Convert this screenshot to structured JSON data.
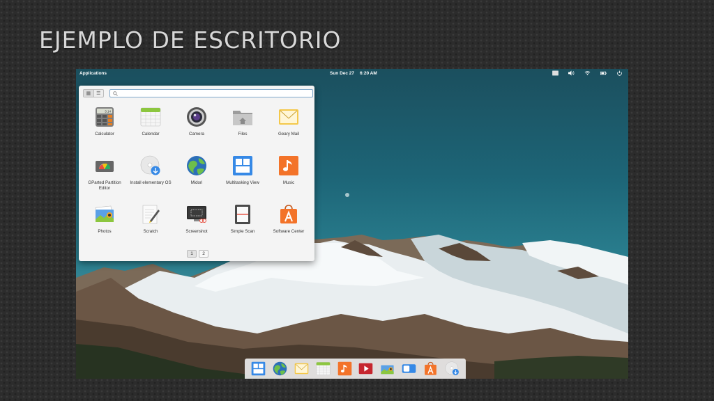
{
  "slide": {
    "title": "EJEMPLO DE ESCRITORIO"
  },
  "panel": {
    "applications_label": "Applications",
    "date": "Sun Dec 27",
    "time": "6:20 AM",
    "indicators": [
      "keyboard-icon",
      "volume-icon",
      "wifi-icon",
      "battery-icon",
      "power-icon"
    ]
  },
  "launcher": {
    "search_value": "",
    "apps": [
      {
        "label": "Calculator",
        "icon": "calculator-icon"
      },
      {
        "label": "Calendar",
        "icon": "calendar-icon"
      },
      {
        "label": "Camera",
        "icon": "camera-icon"
      },
      {
        "label": "Files",
        "icon": "files-icon"
      },
      {
        "label": "Geary Mail",
        "icon": "mail-icon"
      },
      {
        "label": "GParted Partition Editor",
        "icon": "gparted-icon"
      },
      {
        "label": "Install elementary OS",
        "icon": "installer-icon"
      },
      {
        "label": "Midori",
        "icon": "midori-icon"
      },
      {
        "label": "Multitasking View",
        "icon": "multitasking-icon"
      },
      {
        "label": "Music",
        "icon": "music-icon"
      },
      {
        "label": "Photos",
        "icon": "photos-icon"
      },
      {
        "label": "Scratch",
        "icon": "scratch-icon"
      },
      {
        "label": "Screenshot",
        "icon": "screenshot-icon"
      },
      {
        "label": "Simple Scan",
        "icon": "scan-icon"
      },
      {
        "label": "Software Center",
        "icon": "software-center-icon"
      }
    ],
    "pages": [
      "1",
      "2"
    ],
    "calculator_display": "3.14"
  },
  "dock": {
    "items": [
      "multitasking-icon",
      "midori-icon",
      "mail-icon",
      "calendar-icon",
      "music-icon",
      "videos-icon",
      "photos-icon",
      "switchboard-icon",
      "software-center-icon",
      "installer-icon"
    ]
  },
  "colors": {
    "sky_top": "#1b4f5e",
    "accent_blue": "#3689e6",
    "orange": "#f37329"
  }
}
